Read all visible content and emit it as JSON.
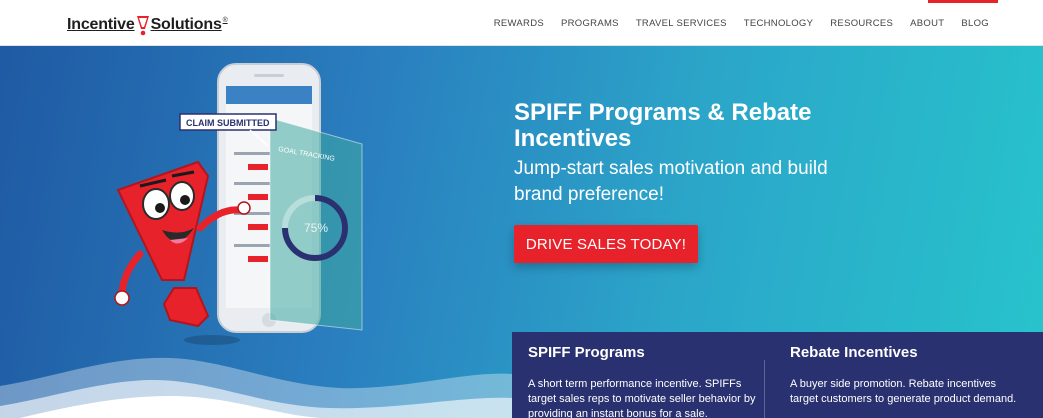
{
  "brand": {
    "name_left": "Incentive",
    "name_right": "Solutions",
    "registered": "®",
    "accent_color": "#e8222b"
  },
  "nav": {
    "items": [
      "REWARDS",
      "PROGRAMS",
      "TRAVEL SERVICES",
      "TECHNOLOGY",
      "RESOURCES",
      "ABOUT",
      "BLOG"
    ]
  },
  "hero": {
    "title": "SPIFF Programs & Rebate Incentives",
    "subtitle": "Jump-start sales motivation and build brand preference!",
    "cta_label": "DRIVE SALES TODAY!",
    "phone": {
      "claim_label": "CLAIM SUBMITTED",
      "goal_tracking": "GOAL TRACKING",
      "progress_label": "75%",
      "progress_value": 0.75
    }
  },
  "cards": [
    {
      "title": "SPIFF Programs",
      "body": "A short term performance incentive. SPIFFs target sales reps to motivate seller behavior by providing an instant bonus for a sale."
    },
    {
      "title": "Rebate Incentives",
      "body": "A buyer side promotion. Rebate incentives target customers to generate product demand."
    }
  ],
  "colors": {
    "card_bg": "#2a3170",
    "hero_gradient_start": "#1f5aa3",
    "hero_gradient_end": "#27c4cc"
  }
}
